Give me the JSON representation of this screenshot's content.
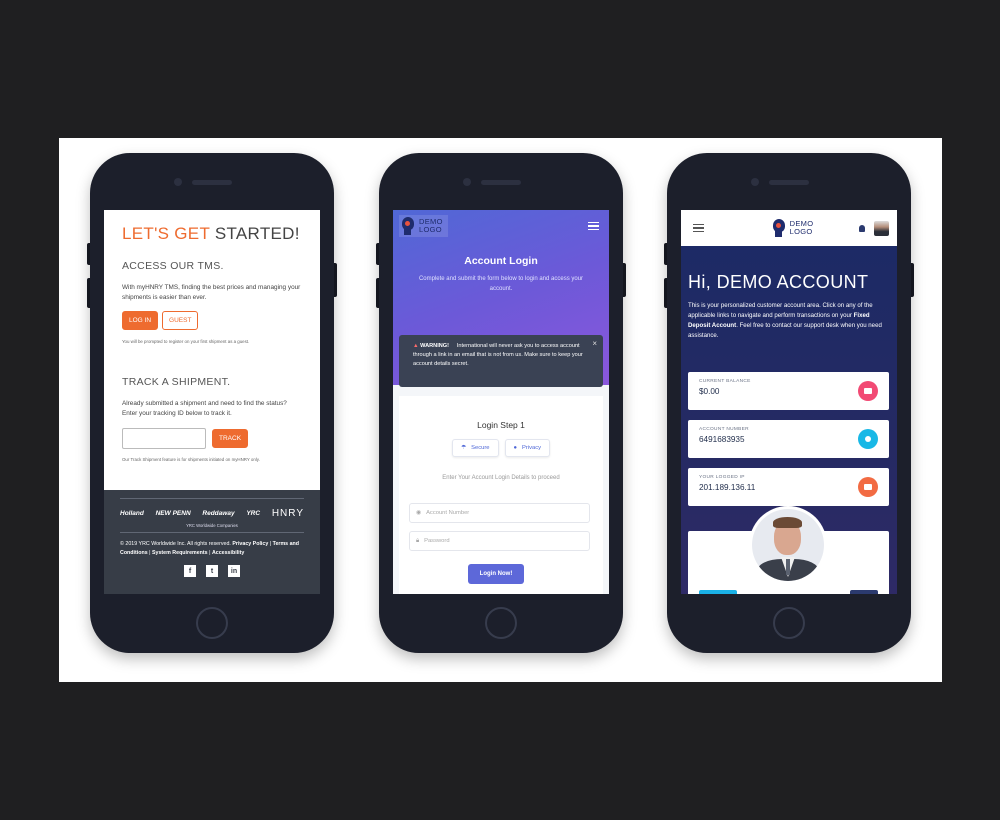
{
  "colors": {
    "accent_orange": "#ee6b2f",
    "purple_gradient_start": "#5068d6",
    "purple_gradient_end": "#8b57dc",
    "navy": "#1b2a66",
    "balance_icon": "#f24a74",
    "account_icon": "#18b8e6",
    "ip_icon": "#f26b43"
  },
  "phone1": {
    "title_part1": "LET'S GET",
    "title_part2": "STARTED!",
    "access_heading": "ACCESS OUR TMS.",
    "access_text": "With myHNRY TMS, finding the best prices and managing your shipments is easier than ever.",
    "login_label": "LOG IN",
    "guest_label": "GUEST",
    "guest_note": "You will be prompted to register on your first shipment as a guest.",
    "track_heading": "TRACK A SHIPMENT.",
    "track_text": "Already submitted a shipment and need to find the status? Enter your tracking ID below to track it.",
    "track_input_value": "",
    "track_label": "TRACK",
    "track_note": "Our Track Shipment feature is for shipments initiated on myHNRY only.",
    "footer": {
      "logos": [
        "Holland",
        "NEW PENN",
        "Reddaway",
        "YRC",
        "HNRY"
      ],
      "yrc_companies": "YRC Worldwide Companies",
      "copyright": "© 2019 YRC Worldwide Inc. All rights reserved.",
      "privacy_policy": "Privacy Policy",
      "terms": "Terms and Conditions",
      "system_requirements": "System Requirements",
      "accessibility": "Accessibility",
      "social": [
        "f",
        "t",
        "in"
      ],
      "social_icons": [
        "facebook-icon",
        "twitter-icon",
        "linkedin-icon"
      ]
    }
  },
  "phone2": {
    "logo_line1": "DEMO",
    "logo_line2": "LOGO",
    "title": "Account Login",
    "subtitle": "Complete and submit the form below to login and access your account.",
    "warning_label": "WARNING!",
    "warning_text": "International will never ask you to access account through a link in an email that is not from us. Make sure to keep your account details secret.",
    "step_title": "Login Step 1",
    "tab_secure": "Secure",
    "tab_privacy": "Privacy",
    "enter_details": "Enter Your Account Login Details to proceed",
    "account_placeholder": "Account Number",
    "password_placeholder": "Password",
    "login_button": "Login Now!"
  },
  "phone3": {
    "logo_line1": "DEMO",
    "logo_line2": "LOGO",
    "greeting": "Hi, DEMO ACCOUNT",
    "intro_part1": "This is your personalized customer account area. Click on any of the applicable links to navigate and perform transactions on your",
    "intro_bold": "Fixed Deposit Account",
    "intro_part2": ". Feel free to contact our support desk when you need assistance.",
    "cards": [
      {
        "label": "CURRENT BALANCE",
        "value": "$0.00",
        "icon": "briefcase-icon"
      },
      {
        "label": "ACCOUNT NUMBER",
        "value": "6491683935",
        "icon": "user-icon"
      },
      {
        "label": "YOUR LOGGED IP",
        "value": "201.189.136.11",
        "icon": "laptop-icon"
      }
    ]
  }
}
